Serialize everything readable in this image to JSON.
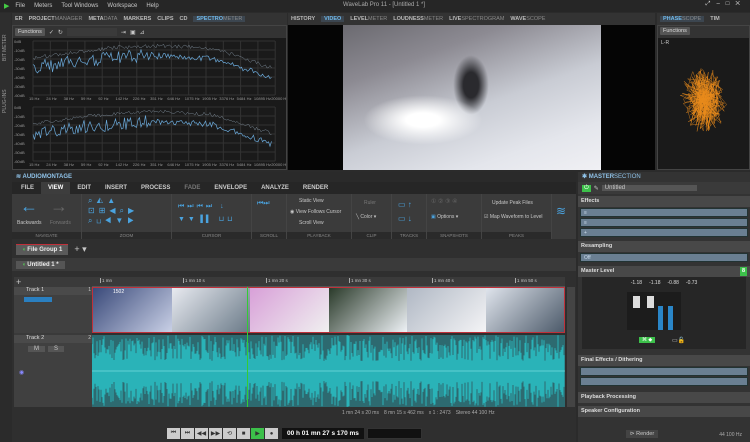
{
  "app": {
    "title": "WaveLab Pro 11 - [Untitled 1 *]",
    "menu": [
      "File",
      "Meters",
      "Tool Windows",
      "Workspace",
      "Help"
    ]
  },
  "side_strip": {
    "labels": [
      "BIT METER",
      "PLUG-INS"
    ]
  },
  "top_left_tabs": [
    {
      "bold": "ER",
      "lite": ""
    },
    {
      "bold": "PROJECT",
      "lite": "MANAGER"
    },
    {
      "bold": "META",
      "lite": "DATA"
    },
    {
      "bold": "MARKERS",
      "lite": ""
    },
    {
      "bold": "CLIPS",
      "lite": ""
    },
    {
      "bold": "CD",
      "lite": ""
    },
    {
      "bold": "SPECTRO",
      "lite": "METER"
    }
  ],
  "top_mid_tabs": [
    {
      "bold": "HISTORY",
      "lite": ""
    },
    {
      "bold": "VIDEO",
      "lite": ""
    },
    {
      "bold": "LEVEL",
      "lite": "METER"
    },
    {
      "bold": "LOUDNESS",
      "lite": "METER"
    },
    {
      "bold": "LIVE",
      "lite": "SPECTROGRAM"
    },
    {
      "bold": "WAVE",
      "lite": "SCOPE"
    }
  ],
  "top_right_tabs": [
    {
      "bold": "PHASE",
      "lite": "SCOPE"
    },
    {
      "bold": "TIM",
      "lite": ""
    }
  ],
  "functions_label": "Functions",
  "phase_label": "L-R",
  "spectrometer": {
    "y_labels": [
      "0dB",
      "-10dB",
      "-20dB",
      "-30dB",
      "-40dB",
      "-50dB",
      "-60dB"
    ],
    "x_labels": [
      "15 Hz",
      "24 Hz",
      "38 Hz",
      "59 Hz",
      "92 Hz",
      "142 Hz",
      "226 Hz",
      "351 Hz",
      "646 Hz",
      "1075 Hz",
      "1905 Hz",
      "3376 Hz",
      "5484 Hz",
      "10895 Hz",
      "20000 Hz"
    ]
  },
  "montage": {
    "title": "AUDIOMONTAGE",
    "ribbon_tabs": [
      "FILE",
      "VIEW",
      "EDIT",
      "INSERT",
      "PROCESS",
      "FADE",
      "ENVELOPE",
      "ANALYZE",
      "RENDER"
    ],
    "active_tab": "VIEW",
    "navigate": {
      "back": "Backwards",
      "fwd": "Forwards",
      "label": "NAVIGATE"
    },
    "groups": {
      "zoom": "ZOOM",
      "cursor": "CURSOR",
      "scroll": "SCROLL",
      "playback": "PLAYBACK",
      "clip": "CLIP",
      "tracks": "TRACKS",
      "snapshots": "SNAPSHOTS",
      "peaks": "PEAKS"
    },
    "playback_options": [
      "Static View",
      "View Follows Cursor",
      "Scroll View"
    ],
    "clip": {
      "ruler": "Ruler",
      "color": "Color"
    },
    "snapshots_options": "Options",
    "peaks": {
      "update": "Update Peak Files",
      "map": "Map Waveform to Level"
    },
    "file_group": "File Group 1",
    "doc_tab": "Untitled 1 *",
    "ruler": [
      "1 mn",
      "1 mn 10 s",
      "1 mn 20 s",
      "1 mn 30 s",
      "1 mn 40 s",
      "1 mn 50 s"
    ],
    "tracks": [
      {
        "name": "Track 1",
        "num": "1"
      },
      {
        "name": "Track 2",
        "num": "2",
        "m": "M",
        "s": "S"
      }
    ],
    "clip_label": "1502",
    "status": {
      "length": "1 mn 24 s 20 ms",
      "sel": "8 mn 15 s 462 ms",
      "zoom": "x 1 : 2473",
      "format": "Stereo 44 100 Hz"
    },
    "time_display": "00 h 01 mn 27 s 170 ms"
  },
  "master": {
    "title_bold": "MASTER",
    "title_lite": "SECTION",
    "preset": "Untitled",
    "effects": "Effects",
    "resampling": "Resampling",
    "resampling_value": "Off",
    "master_level": "Master Level",
    "levels": [
      "-1.18",
      "-1.18",
      "-0.88",
      "-0.73"
    ],
    "final": "Final Effects / Dithering",
    "playback": "Playback Processing",
    "speaker": "Speaker Configuration",
    "render": "Render",
    "rate": "44 100 Hz"
  },
  "colors": {
    "accent": "#4aa3df",
    "waveform": "#2ab3b8",
    "play": "#3cc04a",
    "clip_border": "#c0303a"
  }
}
